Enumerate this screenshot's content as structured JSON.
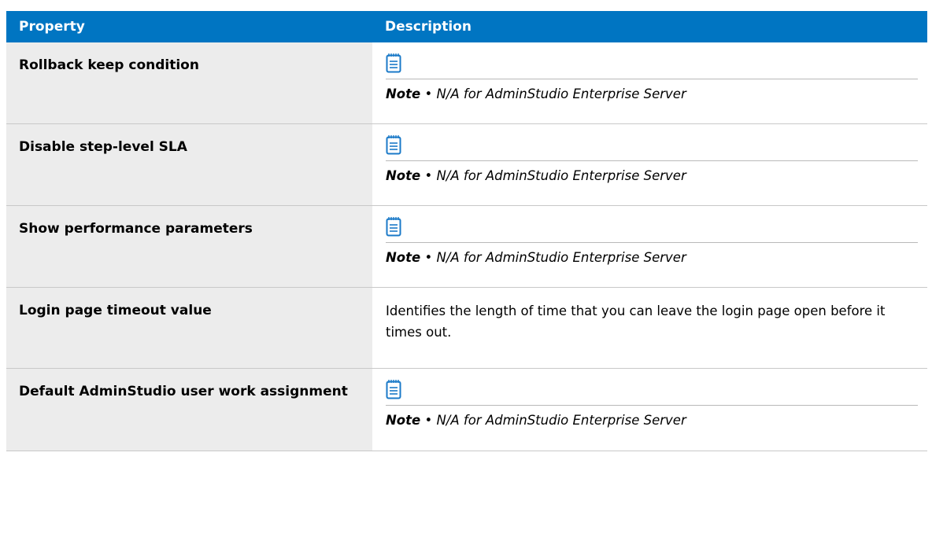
{
  "table": {
    "header": {
      "property": "Property",
      "description": "Description"
    },
    "rows": [
      {
        "property": "Rollback keep condition",
        "note_label": "Note",
        "note_separator": "•",
        "note_text": "N/A for AdminStudio Enterprise Server"
      },
      {
        "property": "Disable step-level SLA",
        "note_label": "Note",
        "note_separator": "•",
        "note_text": "N/A for AdminStudio Enterprise Server"
      },
      {
        "property": "Show performance parameters",
        "note_label": "Note",
        "note_separator": "•",
        "note_text": "N/A for AdminStudio Enterprise Server"
      },
      {
        "property": "Login page timeout value",
        "description": "Identifies the length of time that you can leave the login page open before it times out."
      },
      {
        "property": "Default AdminStudio user work assignment",
        "note_label": "Note",
        "note_separator": "•",
        "note_text": "N/A for AdminStudio Enterprise Server"
      }
    ]
  },
  "colors": {
    "header_bg": "#0075c2",
    "property_bg": "#ececec",
    "icon": "#1b7ac8"
  },
  "icons": {
    "note": "notepad-icon"
  }
}
